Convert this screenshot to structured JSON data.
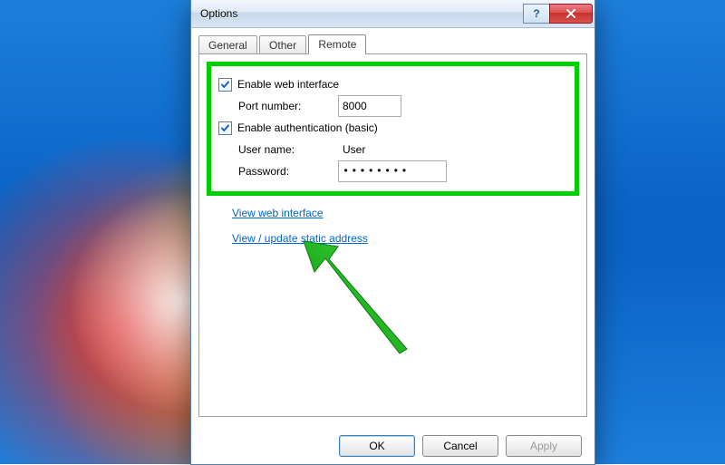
{
  "window": {
    "title": "Options"
  },
  "tabs": {
    "general": "General",
    "other": "Other",
    "remote": "Remote"
  },
  "remote": {
    "enable_web_label": "Enable web interface",
    "enable_web_checked": true,
    "port_label": "Port number:",
    "port_value": "8000",
    "enable_auth_label": "Enable authentication (basic)",
    "enable_auth_checked": true,
    "user_label": "User name:",
    "user_value": "User",
    "pass_label": "Password:",
    "pass_value": "••••••••",
    "link_view": "View web interface",
    "link_static": "View / update static address"
  },
  "buttons": {
    "ok": "OK",
    "cancel": "Cancel",
    "apply": "Apply"
  },
  "colors": {
    "highlight": "#00d000",
    "link": "#0066cc"
  }
}
